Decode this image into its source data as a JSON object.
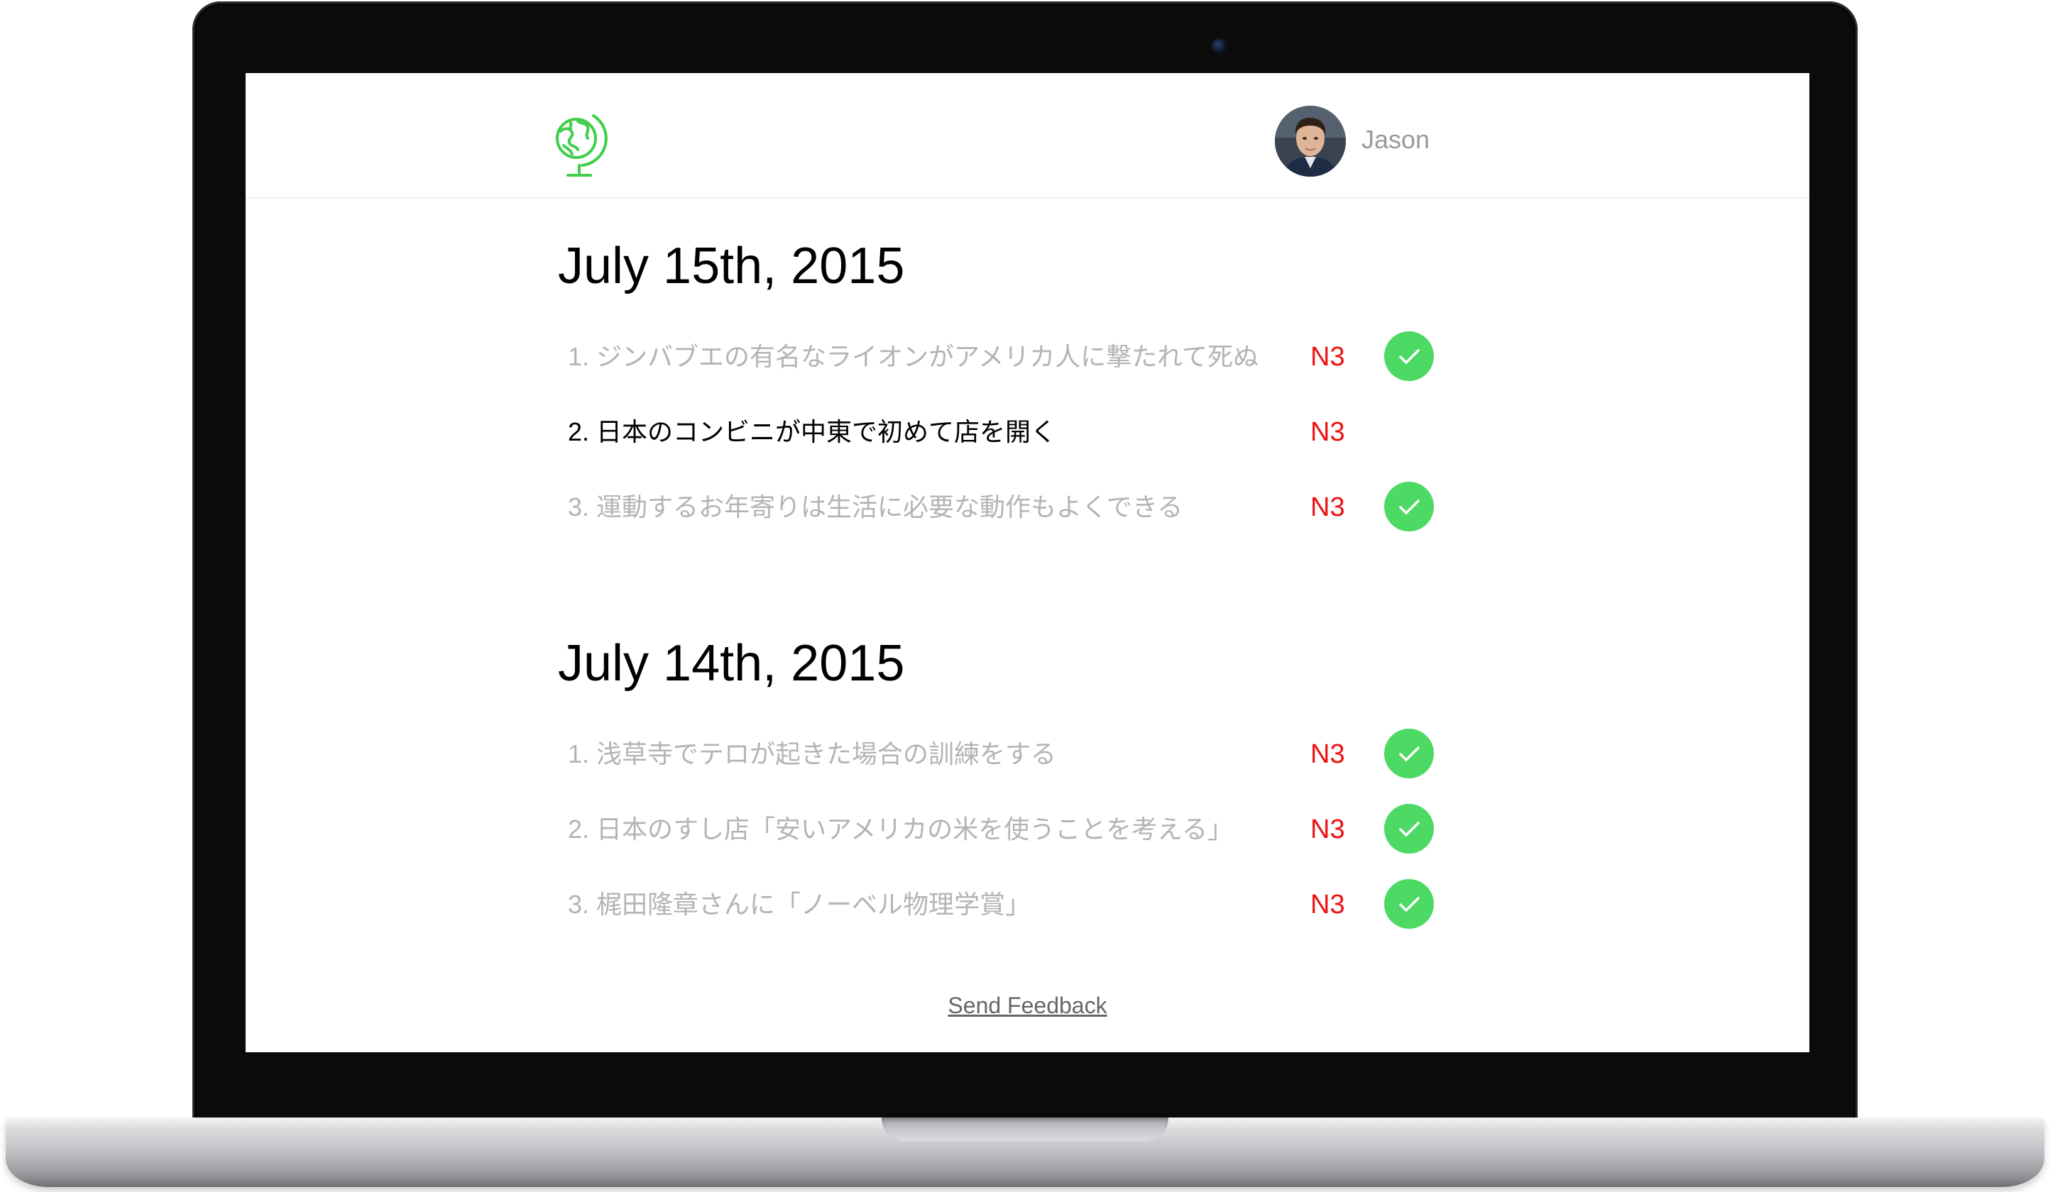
{
  "user": {
    "name": "Jason"
  },
  "colors": {
    "brand_green": "#3fcf4a",
    "check_green": "#4cd964",
    "level_red": "#ee1111",
    "read_text": "#b4b4b4",
    "unread_text": "#000000"
  },
  "icons": {
    "logo": "globe-icon",
    "done": "checkmark-icon"
  },
  "days": [
    {
      "date": "July 15th, 2015",
      "articles": [
        {
          "title": "1. ジンバブエの有名なライオンがアメリカ人に撃たれて死ぬ",
          "level": "N3",
          "read": true
        },
        {
          "title": "2. 日本のコンビニが中東で初めて店を開く",
          "level": "N3",
          "read": false
        },
        {
          "title": "3. 運動するお年寄りは生活に必要な動作もよくできる",
          "level": "N3",
          "read": true
        }
      ]
    },
    {
      "date": "July 14th, 2015",
      "articles": [
        {
          "title": "1. 浅草寺でテロが起きた場合の訓練をする",
          "level": "N3",
          "read": true
        },
        {
          "title": "2. 日本のすし店「安いアメリカの米を使うことを考える」",
          "level": "N3",
          "read": true
        },
        {
          "title": "3. 梶田隆章さんに「ノーベル物理学賞」",
          "level": "N3",
          "read": true
        }
      ]
    }
  ],
  "footer": {
    "feedback_label": "Send Feedback"
  }
}
